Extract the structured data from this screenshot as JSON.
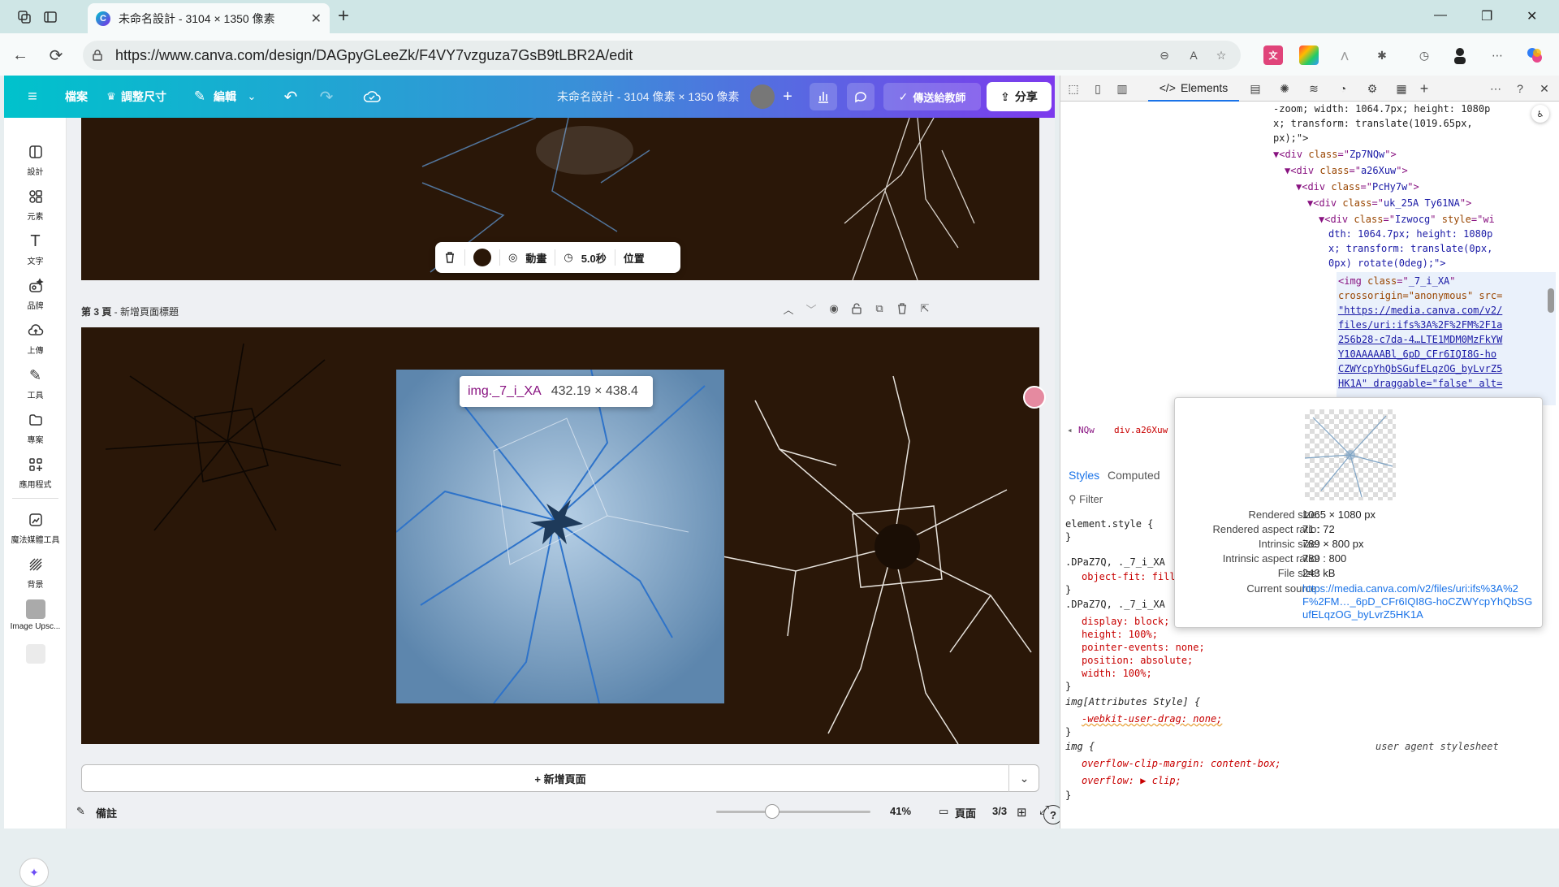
{
  "browser": {
    "tab_title": "未命名設計 - 3104 × 1350 像素",
    "tab_favicon": "C",
    "url": "https://www.canva.com/design/DAGpyGLeeZk/F4VY7vzguza7GsB9tLBR2A/edit"
  },
  "canva": {
    "menu_file": "檔案",
    "menu_resize": "調整尺寸",
    "menu_edit": "編輯",
    "doc_title": "未命名設計 - 3104 像素 × 1350 像素",
    "send_teacher": "傳送給教師",
    "share": "分享",
    "sidebar": [
      {
        "icon": "layout-icon",
        "label": "設計"
      },
      {
        "icon": "shapes-icon",
        "label": "元素"
      },
      {
        "icon": "text-icon",
        "label": "文字"
      },
      {
        "icon": "brand-icon",
        "label": "品牌"
      },
      {
        "icon": "upload-icon",
        "label": "上傳"
      },
      {
        "icon": "draw-icon",
        "label": "工具"
      },
      {
        "icon": "folder-icon",
        "label": "專案"
      },
      {
        "icon": "apps-icon",
        "label": "應用程式"
      },
      {
        "icon": "magic-media-icon",
        "label": "魔法媒體工具"
      },
      {
        "icon": "background-icon",
        "label": "背景"
      },
      {
        "icon": "image-upscaler-icon",
        "label": "Image Upsc..."
      }
    ],
    "floating_toolbar": {
      "animate": "動畫",
      "duration": "5.0秒",
      "position": "位置"
    },
    "page_label_num": "第 3 頁",
    "page_label_title": " - 新增頁面標題",
    "element_tooltip": {
      "name": "img._7_i_XA",
      "dims": "432.19 × 438.4"
    },
    "add_page": "+ 新增頁面",
    "notes": "備註",
    "zoom": "41%",
    "zoom_fraction": 0.41,
    "pages_label": "頁面",
    "page_count": "3/3"
  },
  "devtools": {
    "elements_tab": "Elements",
    "styles_tab": "Styles",
    "computed_tab": "Computed",
    "filter_placeholder": "Filter",
    "html_lines": [
      "-zoom; width: 1064.7px; height: 1080p",
      "x; transform: translate(1019.65px,",
      "px);\">",
      "Zp7NQw",
      "a26Xuw",
      "PcHy7w",
      "uk_25A Ty61NA",
      "Izwocg",
      "dth: 1064.7px; height: 1080p",
      "x; transform: translate(0px,",
      "0px) rotate(0deg);\">",
      "_7_i_XA",
      "crossorigin=\"anonymous\" src=",
      "\"https://media.canva.com/v2/",
      "files/uri:ifs%3A%2F%2FM%2F1a",
      "256b28-c7da-4…LTE1MDM0MzFkYW",
      "Y10AAAAABl_6pD_CFr6IQI8G-ho",
      "CZWYcpYhQbSGufELqzOG_byLvrZ5",
      "HK1A\" draggable=\"false\" alt="
    ],
    "breadcrumb": [
      "NQw",
      "div.a26Xuw"
    ],
    "css": {
      "element_style": "element.style {",
      "rule1_sel": ".DPaZ7Q, ._7_i_XA",
      "rule1_prop": "object-fit: fill",
      "rule2_sel": ".DPaZ7Q, ._7_i_XA",
      "rule2_props": [
        "display: block;",
        "height: 100%;",
        "pointer-events: none;",
        "position: absolute;",
        "width: 100%;"
      ],
      "rule3_sel": "img[Attributes Style] {",
      "rule3_prop": "-webkit-user-drag: none;",
      "rule4_sel": "img {",
      "rule4_note": "user agent stylesheet",
      "rule4_props": [
        "overflow-clip-margin: content-box;",
        "overflow: ▶ clip;"
      ]
    },
    "popup": {
      "rows": [
        {
          "k": "Rendered size:",
          "v": "1065 × 1080 px"
        },
        {
          "k": "Rendered aspect ratio:",
          "v": "71 : 72"
        },
        {
          "k": "Intrinsic size:",
          "v": "789 × 800 px"
        },
        {
          "k": "Intrinsic aspect ratio:",
          "v": "789 : 800"
        },
        {
          "k": "File size:",
          "v": "243 kB"
        }
      ],
      "source_label": "Current source:",
      "source_url": "https://media.canva.com/v2/files/uri:ifs%3A%2F%2FM…_6pD_CFr6IQI8G-hoCZWYcpYhQbSGufELqzOG_byLvrZ5HK1A"
    }
  },
  "colors": {
    "canvas_bg": "#2a1708",
    "accent": "#7c3aed",
    "devtools_tag": "#881280"
  }
}
